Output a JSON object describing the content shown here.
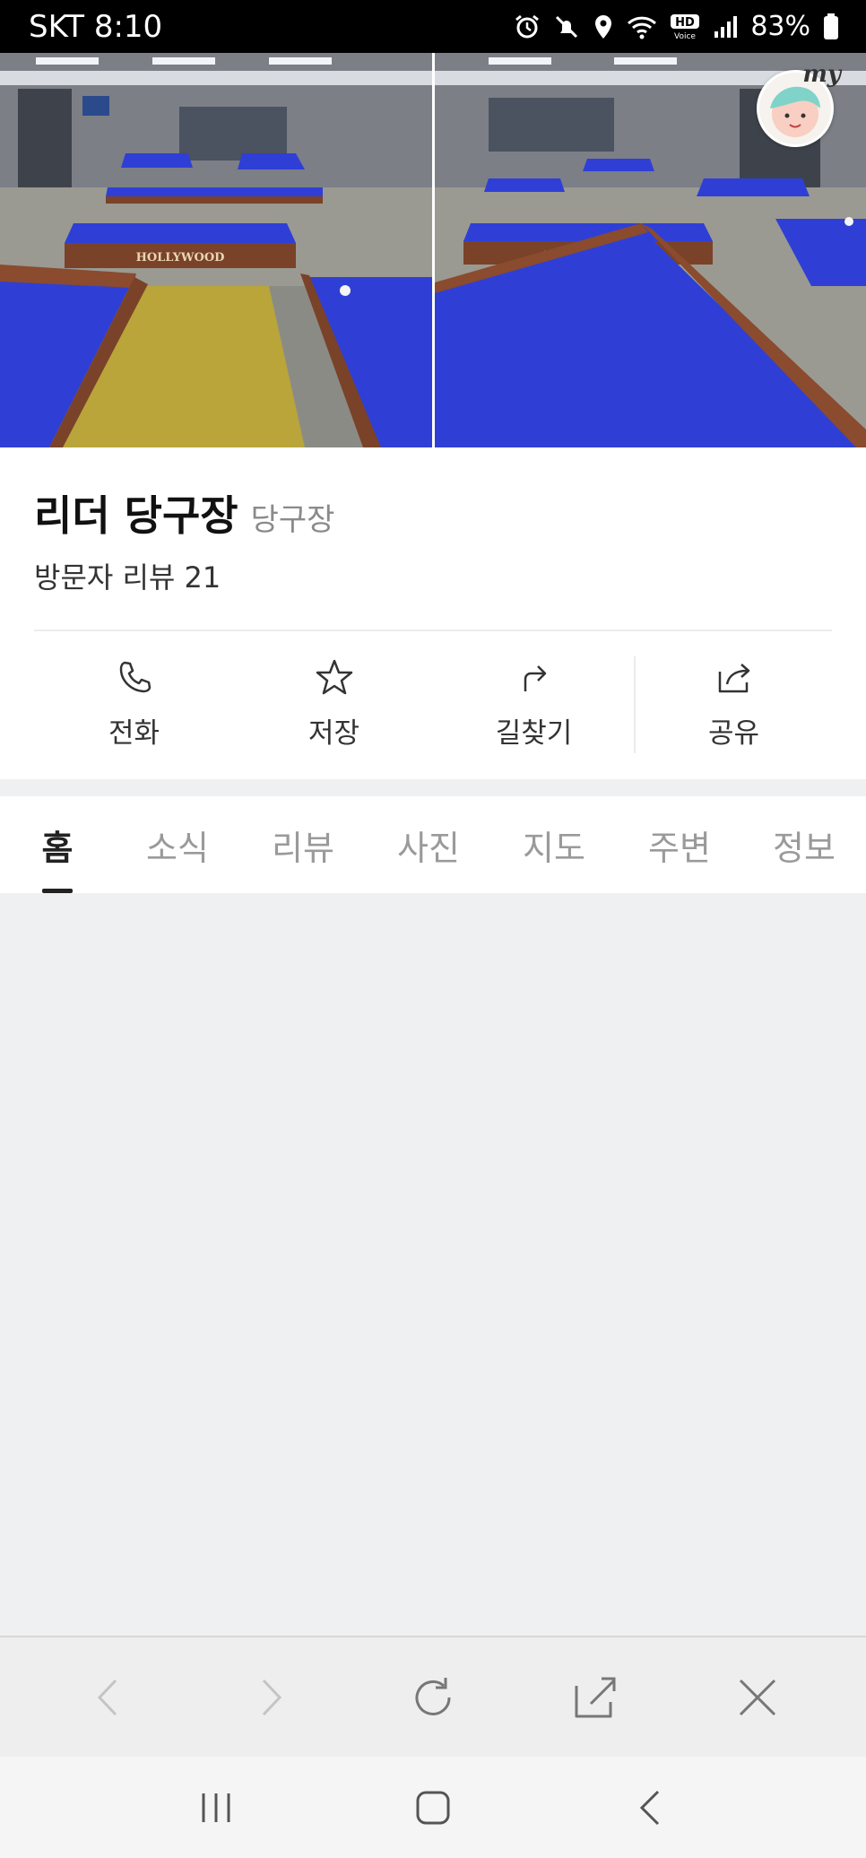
{
  "status_bar": {
    "carrier_time": "SKT 8:10",
    "battery": "83%",
    "icons": [
      "alarm-icon",
      "mute-icon",
      "location-icon",
      "wifi-icon",
      "hd-voice-icon",
      "signal-icon",
      "battery-icon"
    ]
  },
  "place": {
    "name": "리더 당구장",
    "category": "당구장",
    "review_text": "방문자 리뷰 21"
  },
  "avatar_badge": "my",
  "actions": [
    {
      "label": "전화",
      "icon": "phone-icon"
    },
    {
      "label": "저장",
      "icon": "star-icon"
    },
    {
      "label": "길찾기",
      "icon": "directions-icon"
    },
    {
      "label": "공유",
      "icon": "share-icon"
    }
  ],
  "tabs": [
    {
      "label": "홈",
      "active": true
    },
    {
      "label": "소식",
      "active": false
    },
    {
      "label": "리뷰",
      "active": false
    },
    {
      "label": "사진",
      "active": false
    },
    {
      "label": "지도",
      "active": false
    },
    {
      "label": "주변",
      "active": false
    },
    {
      "label": "정보",
      "active": false
    }
  ],
  "browser_bar": [
    "back-icon",
    "forward-icon",
    "refresh-icon",
    "share-icon",
    "close-icon"
  ],
  "nav_bar": [
    "recent-apps-icon",
    "home-icon",
    "back-icon"
  ],
  "colors": {
    "felt": "#2f3fd6",
    "rail": "#7a4228",
    "floor_yellow": "#b9a53a",
    "floor_gray": "#8b8b86"
  }
}
